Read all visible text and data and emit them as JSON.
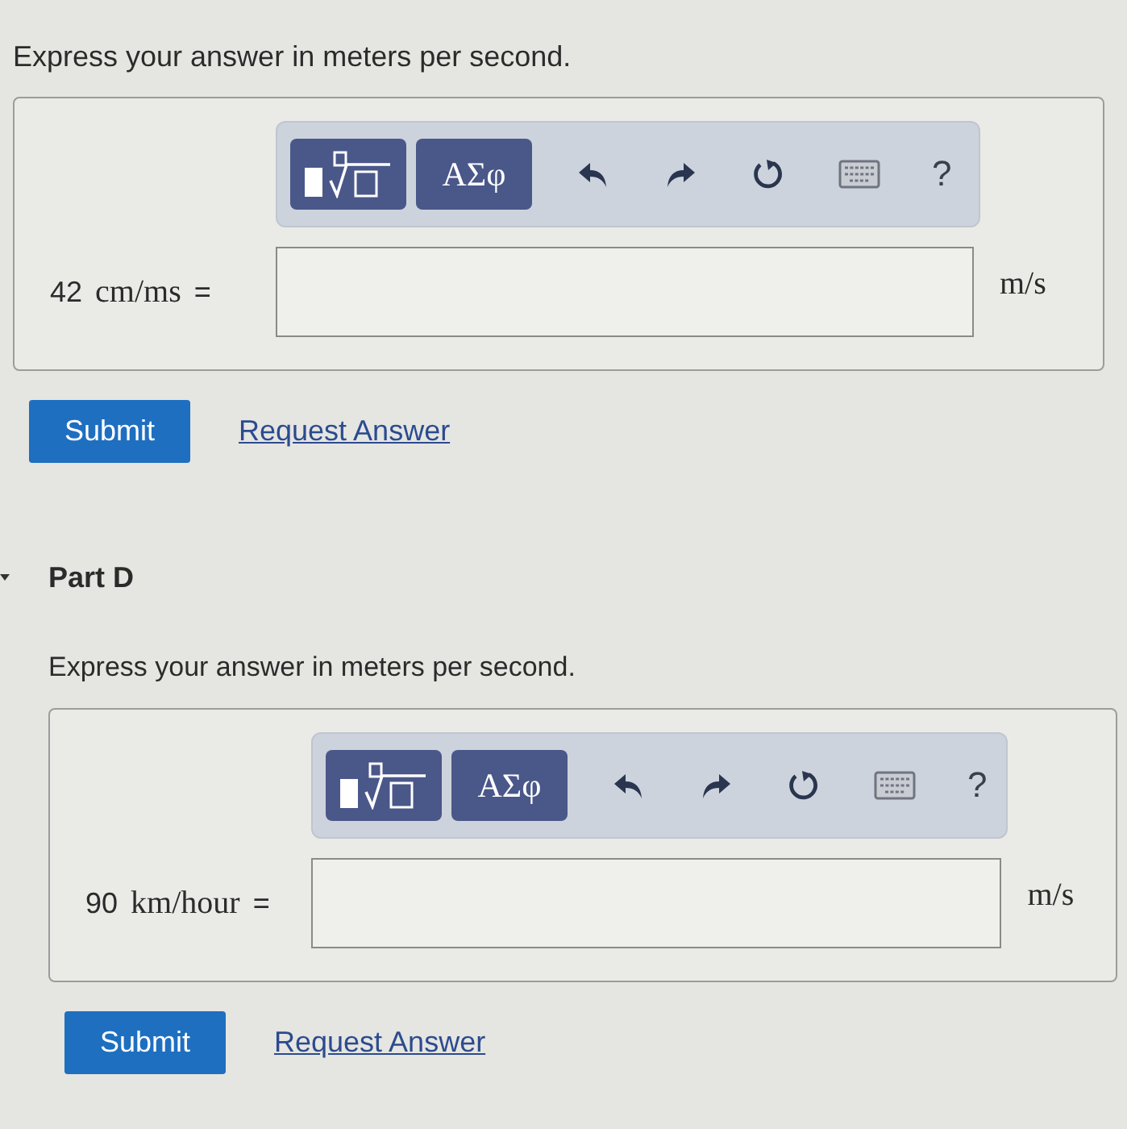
{
  "parts": [
    {
      "kind": "continued",
      "prompt": "Express your answer in meters per second.",
      "toolbar": {
        "greek_label": "ΑΣφ",
        "help_label": "?"
      },
      "equation": {
        "value": "42",
        "unit": "cm/ms",
        "equals": "=",
        "answer_unit": "m/s"
      },
      "submit": "Submit",
      "request_answer": "Request Answer"
    },
    {
      "kind": "part",
      "title": "Part D",
      "prompt": "Express your answer in meters per second.",
      "toolbar": {
        "greek_label": "ΑΣφ",
        "help_label": "?"
      },
      "equation": {
        "value": "90",
        "unit": "km/hour",
        "equals": "=",
        "answer_unit": "m/s"
      },
      "submit": "Submit",
      "request_answer": "Request Answer"
    }
  ]
}
